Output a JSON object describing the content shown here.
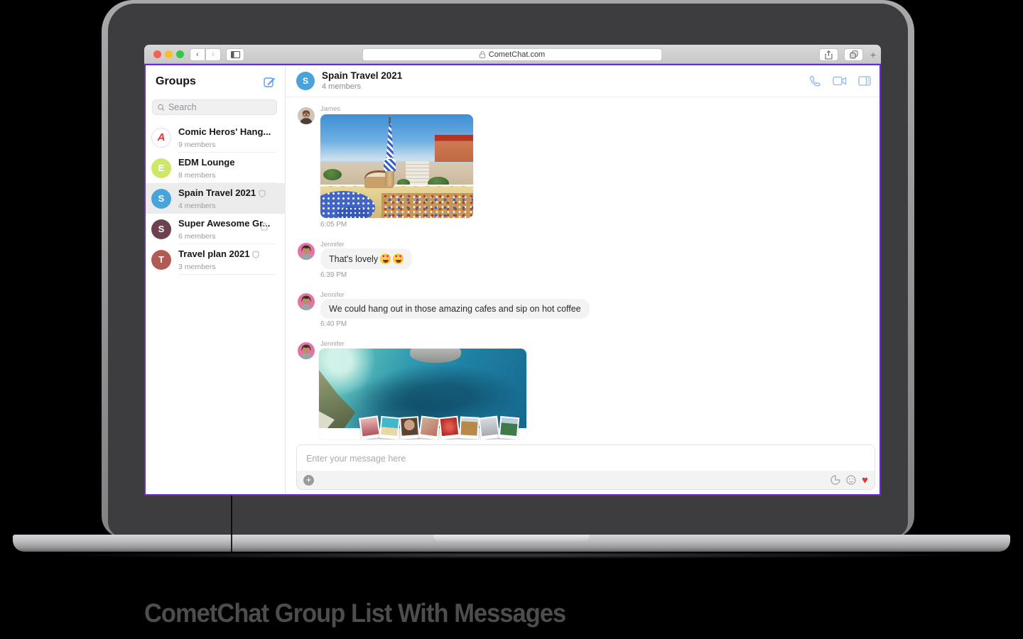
{
  "browser": {
    "url": "CometChat.com",
    "traffic_lights": {
      "close_color": "#f95e56",
      "minimize_color": "#fbbd2e",
      "zoom_color": "#33c748"
    }
  },
  "sidebar": {
    "title": "Groups",
    "search_placeholder": "Search",
    "groups": [
      {
        "name": "Comic Heros' Hang...",
        "members": "9 members",
        "avatar_letter": "A",
        "avatar_color": "#ffffff",
        "badge": "none"
      },
      {
        "name": "EDM Lounge",
        "members": "8 members",
        "avatar_letter": "E",
        "avatar_color": "#cde76a",
        "badge": "none"
      },
      {
        "name": "Spain Travel 2021",
        "members": "4 members",
        "avatar_letter": "S",
        "avatar_color": "#4aa4da",
        "badge": "shield",
        "selected": true
      },
      {
        "name": "Super Awesome Gr...",
        "members": "6 members",
        "avatar_letter": "S",
        "avatar_color": "#6d4150",
        "badge": "lock"
      },
      {
        "name": "Travel plan 2021",
        "members": "3 members",
        "avatar_letter": "T",
        "avatar_color": "#b25b54",
        "badge": "shield"
      }
    ]
  },
  "chat": {
    "title": "Spain Travel 2021",
    "subtitle": "4 members",
    "avatar_letter": "S",
    "messages": [
      {
        "sender": "James",
        "kind": "image",
        "description": "Park Guell Barcelona photo",
        "time": "6:05 PM"
      },
      {
        "sender": "Jennifer",
        "kind": "text",
        "text": "That's lovely",
        "emojis": "heart-eyes x2",
        "time": "6:39 PM"
      },
      {
        "sender": "Jennifer",
        "kind": "text",
        "text": "We could hang out in those amazing cafes and sip on hot coffee",
        "time": "6:40 PM"
      },
      {
        "sender": "Jennifer",
        "kind": "image",
        "description": "Sea cove photo with travel polaroid collage",
        "time": ""
      }
    ]
  },
  "composer": {
    "placeholder": "Enter your message here"
  },
  "caption": "CometChat Group List With Messages",
  "colors": {
    "accent_border": "#6b2ad2",
    "action_icons": "#92b7ef",
    "heart": "#cf3f38",
    "selected_row": "#ececec"
  }
}
